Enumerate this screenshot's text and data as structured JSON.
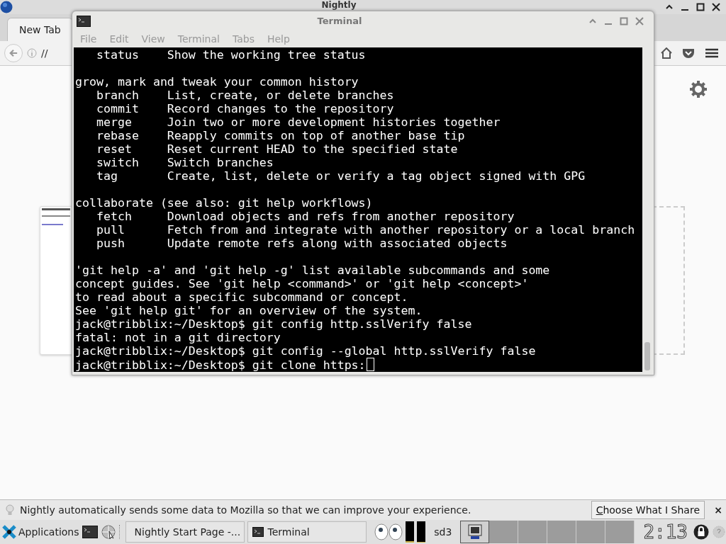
{
  "browser": {
    "title": "Nightly",
    "tabs": [
      {
        "label": "New Tab",
        "selected": true
      }
    ],
    "url": "//"
  },
  "terminal": {
    "title": "Terminal",
    "menu": [
      "File",
      "Edit",
      "View",
      "Terminal",
      "Tabs",
      "Help"
    ],
    "blocks": [
      [
        "   status    Show the working tree status"
      ],
      [
        "grow, mark and tweak your common history",
        "   branch    List, create, or delete branches",
        "   commit    Record changes to the repository",
        "   merge     Join two or more development histories together",
        "   rebase    Reapply commits on top of another base tip",
        "   reset     Reset current HEAD to the specified state",
        "   switch    Switch branches",
        "   tag       Create, list, delete or verify a tag object signed with GPG"
      ],
      [
        "collaborate (see also: git help workflows)",
        "   fetch     Download objects and refs from another repository",
        "   pull      Fetch from and integrate with another repository or a local branch",
        "   push      Update remote refs along with associated objects"
      ],
      [
        "'git help -a' and 'git help -g' list available subcommands and some",
        "concept guides. See 'git help <command>' or 'git help <concept>'",
        "to read about a specific subcommand or concept.",
        "See 'git help git' for an overview of the system.",
        "jack@tribblix:~/Desktop$ git config http.sslVerify false",
        "fatal: not in a git directory",
        "jack@tribblix:~/Desktop$ git config --global http.sslVerify false",
        "jack@tribblix:~/Desktop$ git clone https:"
      ]
    ],
    "cursor": true
  },
  "notification": {
    "message": "Nightly automatically sends some data to Mozilla so that we can improve your experience.",
    "button": "Choose What I Share",
    "close": "×"
  },
  "taskbar": {
    "applications": "Applications",
    "tasks": [
      {
        "label": "Nightly Start Page -...",
        "kind": "globe",
        "selected": false
      },
      {
        "label": "Terminal",
        "kind": "terminal",
        "selected": false
      }
    ],
    "meters": [
      {
        "level": 0.08
      },
      {
        "level": 0.05
      }
    ],
    "hostname": "sd3",
    "workspaces": [
      {
        "selected": true
      },
      {
        "selected": false
      },
      {
        "selected": false
      },
      {
        "selected": false
      },
      {
        "selected": false
      },
      {
        "selected": false
      }
    ],
    "clock": "2:13"
  }
}
